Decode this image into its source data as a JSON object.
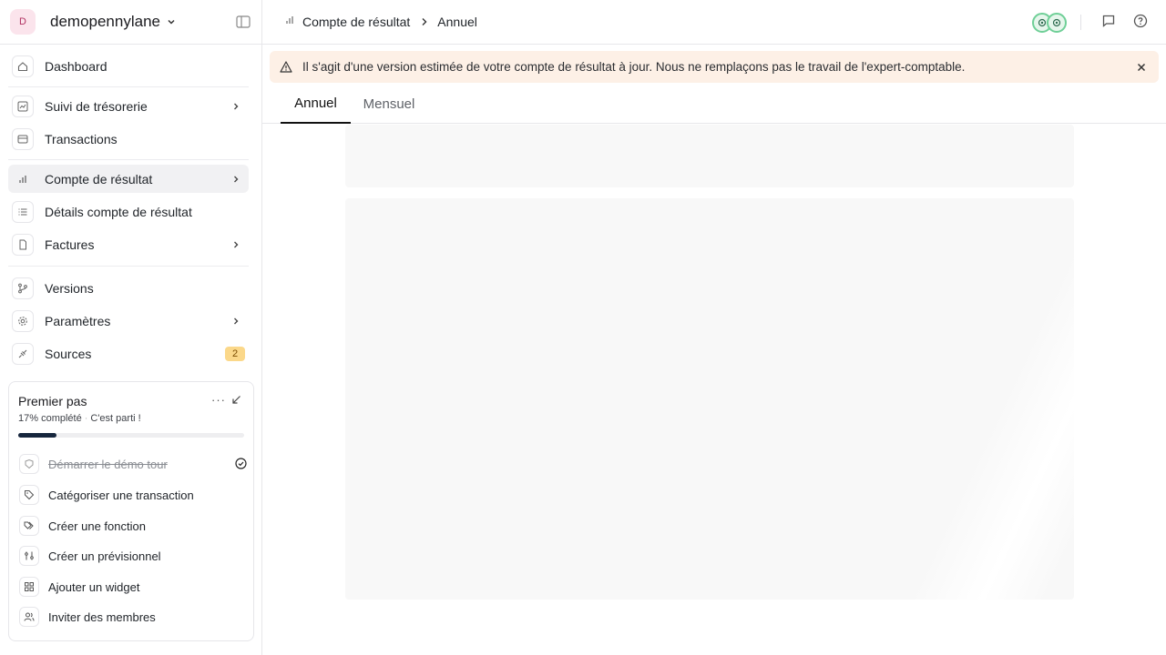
{
  "workspace": {
    "avatar_letter": "D",
    "name": "demopennylane"
  },
  "sidebar": {
    "items": [
      {
        "label": "Dashboard",
        "icon": "home-icon"
      },
      {
        "label": "Suivi de trésorerie",
        "icon": "chart-line-icon",
        "has_submenu": true
      },
      {
        "label": "Transactions",
        "icon": "list-icon"
      },
      {
        "label": "Compte de résultat",
        "icon": "bar-chart-icon",
        "has_submenu": true,
        "active": true
      },
      {
        "label": "Détails compte de résultat",
        "icon": "list-details-icon"
      },
      {
        "label": "Factures",
        "icon": "file-icon",
        "has_submenu": true
      },
      {
        "label": "Versions",
        "icon": "git-branch-icon"
      },
      {
        "label": "Paramètres",
        "icon": "gear-icon",
        "has_submenu": true
      },
      {
        "label": "Sources",
        "icon": "plug-icon",
        "badge": "2"
      }
    ]
  },
  "getting_started": {
    "title": "Premier pas",
    "more": "···",
    "progress_label": "17% complété",
    "cta": "C'est parti !",
    "progress": 0.17,
    "tasks": [
      {
        "label": "Démarrer le démo tour",
        "icon": "tour-icon",
        "done": true
      },
      {
        "label": "Catégoriser une transaction",
        "icon": "tag-icon",
        "done": false
      },
      {
        "label": "Créer une fonction",
        "icon": "tags-icon",
        "done": false
      },
      {
        "label": "Créer un prévisionnel",
        "icon": "forecast-icon",
        "done": false
      },
      {
        "label": "Ajouter un widget",
        "icon": "widget-icon",
        "done": false
      },
      {
        "label": "Inviter des membres",
        "icon": "users-icon",
        "done": false
      }
    ]
  },
  "header": {
    "breadcrumb_1": "Compte de résultat",
    "breadcrumb_2": "Annuel"
  },
  "alert": {
    "text": "Il s'agit d'une version estimée de votre compte de résultat à jour. Nous ne remplaçons pas le travail de l'expert-comptable."
  },
  "tabs": [
    {
      "label": "Annuel",
      "active": true
    },
    {
      "label": "Mensuel",
      "active": false
    }
  ],
  "colors": {
    "accent": "#16263d",
    "alert_bg": "#fdf0e6",
    "badge_bg": "#fbd88a",
    "presence": "#6fcf97"
  }
}
